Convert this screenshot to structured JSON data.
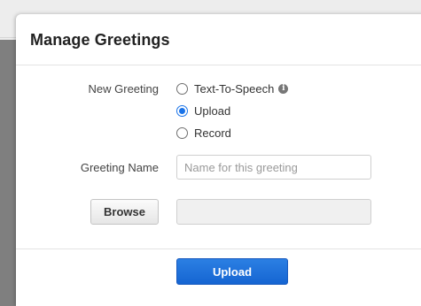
{
  "modal": {
    "title": "Manage Greetings"
  },
  "form": {
    "new_greeting_label": "New Greeting",
    "options": [
      {
        "label": "Text-To-Speech",
        "selected": false,
        "has_info": true
      },
      {
        "label": "Upload",
        "selected": true,
        "has_info": false
      },
      {
        "label": "Record",
        "selected": false,
        "has_info": false
      }
    ],
    "greeting_name_label": "Greeting Name",
    "greeting_name_value": "",
    "greeting_name_placeholder": "Name for this greeting",
    "browse_label": "Browse",
    "file_value": ""
  },
  "footer": {
    "upload_label": "Upload"
  },
  "icons": {
    "info": "info-icon",
    "info_glyph": "i"
  },
  "colors": {
    "accent": "#1a73e8",
    "primary_button": "#1565d2"
  }
}
